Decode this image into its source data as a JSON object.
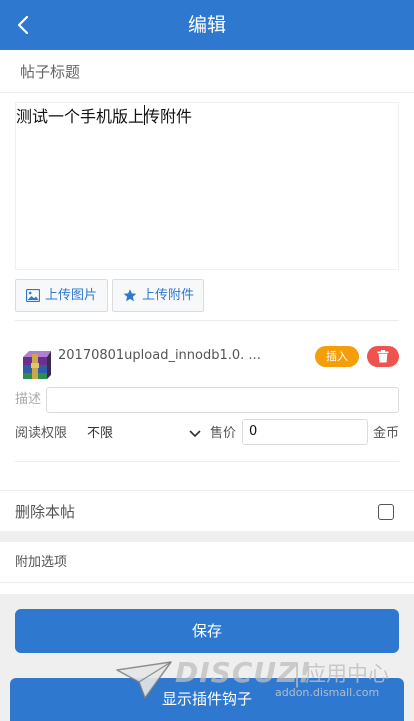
{
  "header": {
    "title": "编辑"
  },
  "form": {
    "title_placeholder": "帖子标题",
    "content": "测试一个手机版上传附件"
  },
  "toolbar": {
    "upload_image": "上传图片",
    "upload_attachment": "上传附件"
  },
  "attachment": {
    "file_name": "20170801upload_innodb1.0. ...",
    "insert_label": "插入",
    "description_label": "描述",
    "description_value": "",
    "permission_label": "阅读权限",
    "permission_value": "不限",
    "price_label": "售价",
    "price_value": "0",
    "price_unit": "金币"
  },
  "options": {
    "delete_post_label": "删除本帖",
    "delete_post_checked": false,
    "extra_options_label": "附加选项"
  },
  "actions": {
    "save_label": "保存",
    "show_hooks_label": "显示插件钩子"
  },
  "watermark": {
    "logo": "DISCUZ!",
    "separator": "|",
    "label": "应用中心",
    "url": "addon.dismall.com"
  },
  "colors": {
    "primary": "#2f78cf",
    "insert": "#f59e0b",
    "delete": "#ef5350"
  }
}
